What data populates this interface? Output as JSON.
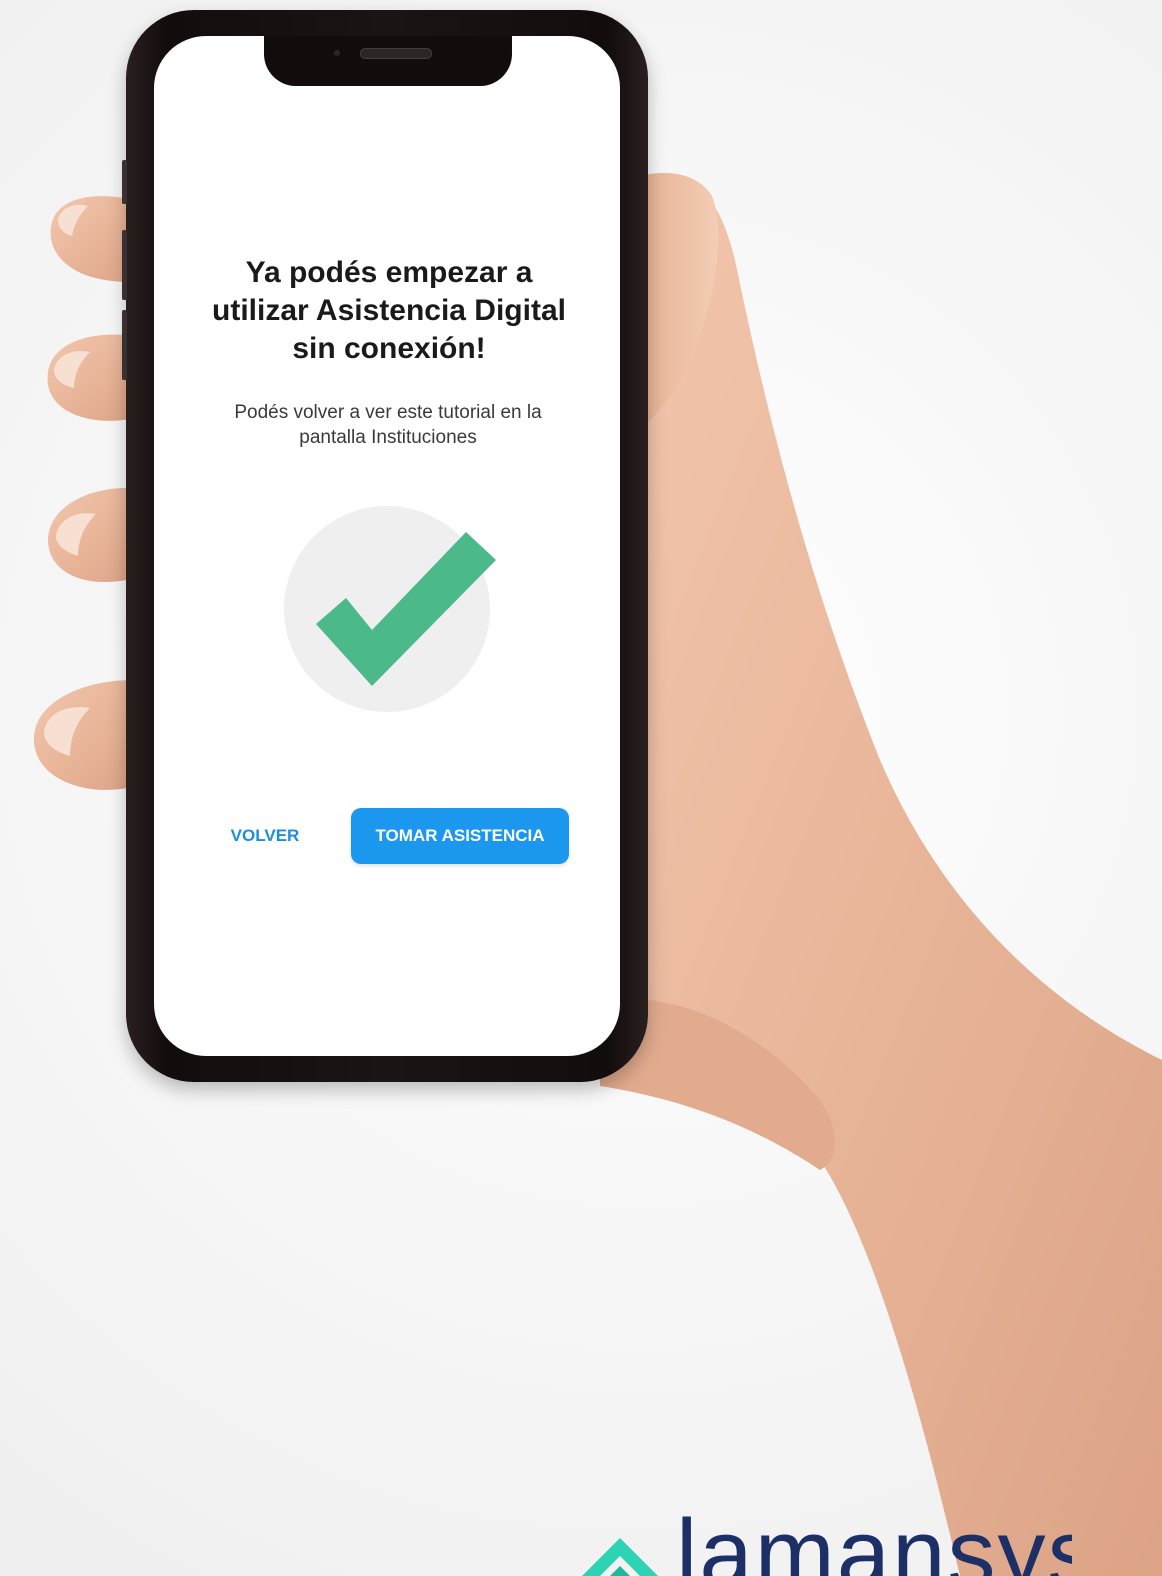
{
  "screen": {
    "title": "Ya podés empezar a utilizar Asistencia Digital sin conexión!",
    "subtitle": "Podés volver a ver este tutorial en la pantalla Instituciones",
    "status_icon": "check-icon",
    "buttons": {
      "back_label": "VOLVER",
      "primary_label": "TOMAR ASISTENCIA"
    }
  },
  "brand": {
    "logo_text": "lamansys",
    "logo_icon": "lamansys-logo-icon"
  },
  "colors": {
    "accent": "#1c97ee",
    "check": "#4cb98a",
    "brand_text": "#1c2f66",
    "brand_mark": "#2ed3b4"
  }
}
